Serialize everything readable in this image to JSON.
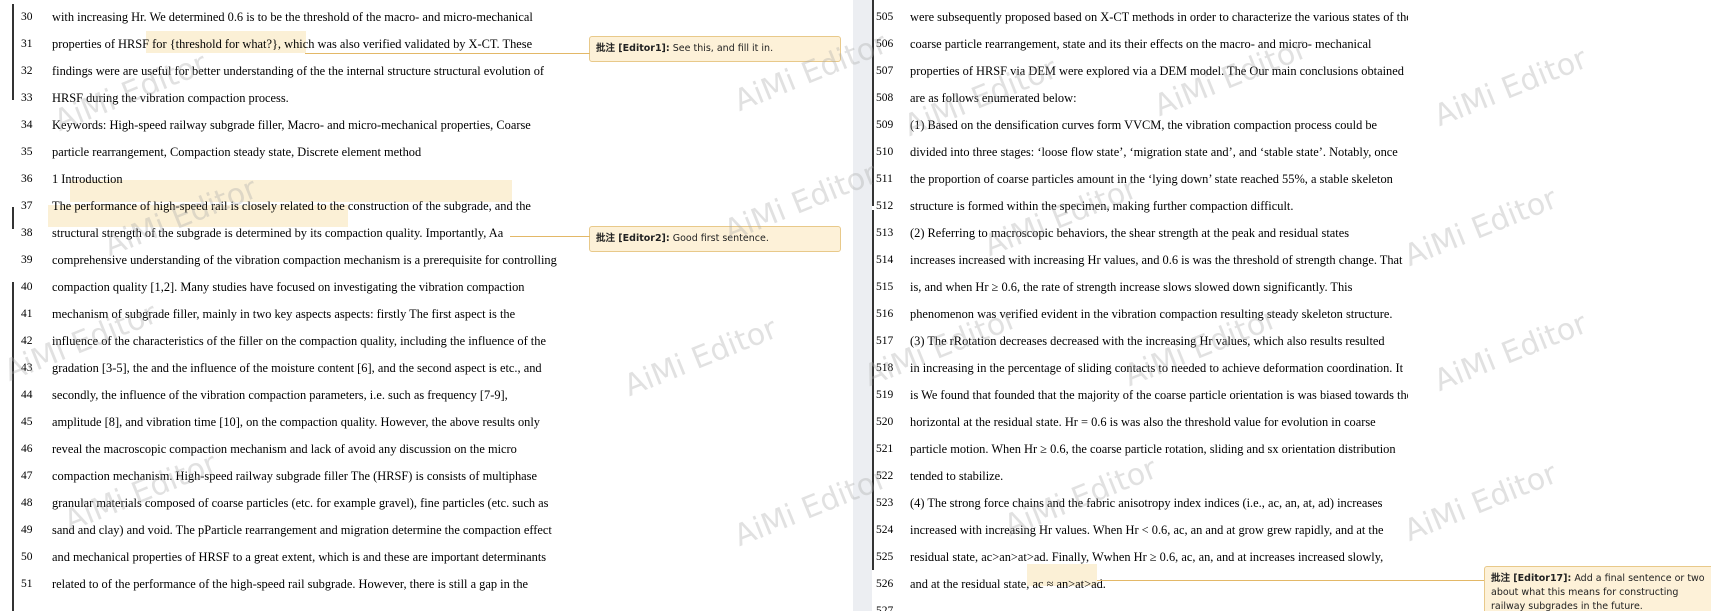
{
  "watermark": "AiMi Editor",
  "left_page": {
    "lines": [
      {
        "num": "30",
        "text": "with increasing Hr. We determined 0.6 is to be the threshold of the macro- and micro-mechanical"
      },
      {
        "num": "31",
        "text": "properties of HRSF for {threshold for what?}, which was also verified validated by X-CT. These"
      },
      {
        "num": "32",
        "text": "findings were are useful for better understanding of the the internal structure structural evolution of"
      },
      {
        "num": "33",
        "text": "HRSF during the vibration compaction process."
      },
      {
        "num": "34",
        "text": "Keywords: High-speed railway subgrade filler, Macro- and micro-mechanical properties, Coarse"
      },
      {
        "num": "35",
        "text": "particle rearrangement, Compaction steady state, Discrete element method"
      },
      {
        "num": "36",
        "text": "1 Introduction"
      },
      {
        "num": "37",
        "text": "The performance of high-speed rail is closely related to the construction of the subgrade, and the"
      },
      {
        "num": "38",
        "text": "structural strength of the subgrade is determined by its compaction quality. Importantly, Aa"
      },
      {
        "num": "39",
        "text": "comprehensive understanding of the vibration compaction mechanism is a prerequisite for controlling"
      },
      {
        "num": "40",
        "text": "compaction quality [1,2]. Many studies have focused on investigating the vibration compaction"
      },
      {
        "num": "41",
        "text": "mechanism of subgrade filler, mainly in two key aspects aspects: firstly The first aspect is the"
      },
      {
        "num": "42",
        "text": "influence of the characteristics of the filler on the compaction quality, including the influence of the"
      },
      {
        "num": "43",
        "text": "gradation [3-5], the and the influence of the moisture content [6], and the second aspect is etc., and"
      },
      {
        "num": "44",
        "text": "secondly, the influence of the vibration compaction parameters, i.e. such as frequency [7-9],"
      },
      {
        "num": "45",
        "text": "amplitude [8], and vibration time [10], on the compaction quality. However, the above results only"
      },
      {
        "num": "46",
        "text": "reveal the macroscopic compaction mechanism and lack of avoid any discussion on the micro"
      },
      {
        "num": "47",
        "text": "compaction mechanism. High-speed railway subgrade filler The (HRSF) is consists of multiphase"
      },
      {
        "num": "48",
        "text": "granular materials composed of coarse particles (etc. for example gravel), fine particles (etc. such as"
      },
      {
        "num": "49",
        "text": "sand and clay) and void. The pParticle rearrangement and migration determine the compaction effect"
      },
      {
        "num": "50",
        "text": "and mechanical properties of HRSF to a great extent, which is and these are important determinants"
      },
      {
        "num": "51",
        "text": "related to of the performance of the high-speed rail subgrade. However, there is still a gap in the"
      }
    ]
  },
  "right_page": {
    "lines": [
      {
        "num": "505",
        "text": "were subsequently proposed based on X-CT methods in order to characterize the various states of the"
      },
      {
        "num": "506",
        "text": "coarse particle rearrangement, state and its their effects on the macro- and micro- mechanical"
      },
      {
        "num": "507",
        "text": "properties of HRSF via DEM were explored via a DEM model. The Our main conclusions obtained"
      },
      {
        "num": "508",
        "text": "are as follows enumerated below:"
      },
      {
        "num": "509",
        "text": "(1) Based on the densification curves form VVCM, the vibration compaction process could be"
      },
      {
        "num": "510",
        "text": "divided into three stages: ‘loose flow state’, ‘migration state and’, and ‘stable state’. Notably, once"
      },
      {
        "num": "511",
        "text": "the proportion of coarse particles amount in the ‘lying down’ state reached 55%, a stable skeleton"
      },
      {
        "num": "512",
        "text": "structure is formed within the specimen, making further compaction difficult."
      },
      {
        "num": "513",
        "text": "(2) Referring to macroscopic behaviors, the shear strength at the peak and residual states"
      },
      {
        "num": "514",
        "text": "increases increased with increasing Hr values, and 0.6 is was the threshold of strength change. That"
      },
      {
        "num": "515",
        "text": "is, and when Hr ≥ 0.6, the rate of strength increase slows slowed down significantly. This"
      },
      {
        "num": "516",
        "text": "phenomenon was verified evident in the vibration compaction resulting steady skeleton structure."
      },
      {
        "num": "517",
        "text": "(3) The rRotation decreases decreased with the increasing Hr values, which also results resulted"
      },
      {
        "num": "518",
        "text": "in increasing in the percentage of sliding contacts to needed to achieve deformation coordination. It"
      },
      {
        "num": "519",
        "text": "is We found that founded that the majority of the coarse particle orientation is was biased towards the"
      },
      {
        "num": "520",
        "text": "horizontal at the residual state. Hr = 0.6 is was also the threshold value for evolution in coarse"
      },
      {
        "num": "521",
        "text": "particle motion. When Hr ≥ 0.6, the coarse particle rotation, sliding and sx orientation distribution"
      },
      {
        "num": "522",
        "text": "tended to stabilize."
      },
      {
        "num": "523",
        "text": "(4) The strong force chains and the fabric anisotropy index indices (i.e., ac, an, at, ad) increases"
      },
      {
        "num": "524",
        "text": "increased with increasing Hr values. When Hr < 0.6, ac, an and at grow grew rapidly, and at the"
      },
      {
        "num": "525",
        "text": "residual state, ac>an>at>ad. Finally, Wwhen Hr ≥ 0.6, ac, an, and at increases increased slowly,"
      },
      {
        "num": "526",
        "text": "and at the residual state, ac ≈ an>at>ad."
      },
      {
        "num": "527",
        "text": ""
      }
    ]
  },
  "comments": [
    {
      "label": "批注 [Editor1]:",
      "text": "See this, and fill it in."
    },
    {
      "label": "批注 [Editor2]:",
      "text": "Good first sentence."
    },
    {
      "label": "批注 [Editor17]:",
      "text": "Add a final sentence or two about what this means for constructing railway subgrades in the future."
    }
  ]
}
